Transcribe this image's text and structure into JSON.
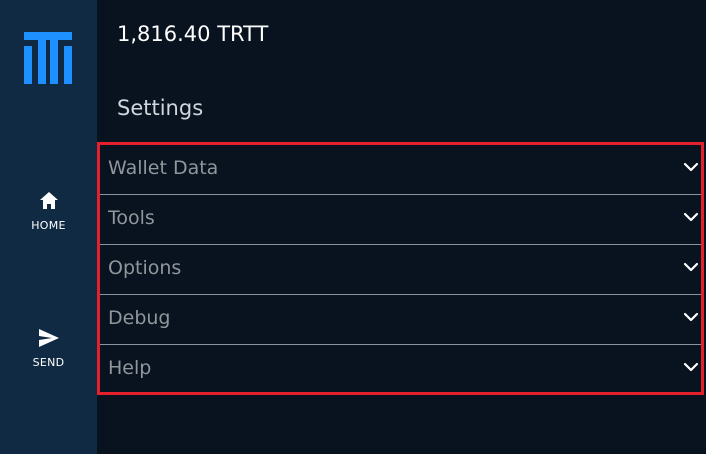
{
  "balance": "1,816.40 TRTT",
  "page_title": "Settings",
  "sidebar": {
    "items": [
      {
        "label": "HOME",
        "icon": "home-icon"
      },
      {
        "label": "SEND",
        "icon": "send-icon"
      }
    ]
  },
  "settings": {
    "items": [
      {
        "label": "Wallet Data"
      },
      {
        "label": "Tools"
      },
      {
        "label": "Options"
      },
      {
        "label": "Debug"
      },
      {
        "label": "Help"
      }
    ]
  },
  "colors": {
    "sidebar_bg": "#102a43",
    "main_bg": "#08131f",
    "logo_blue": "#1e90ff",
    "highlight_red": "#e3202b"
  }
}
